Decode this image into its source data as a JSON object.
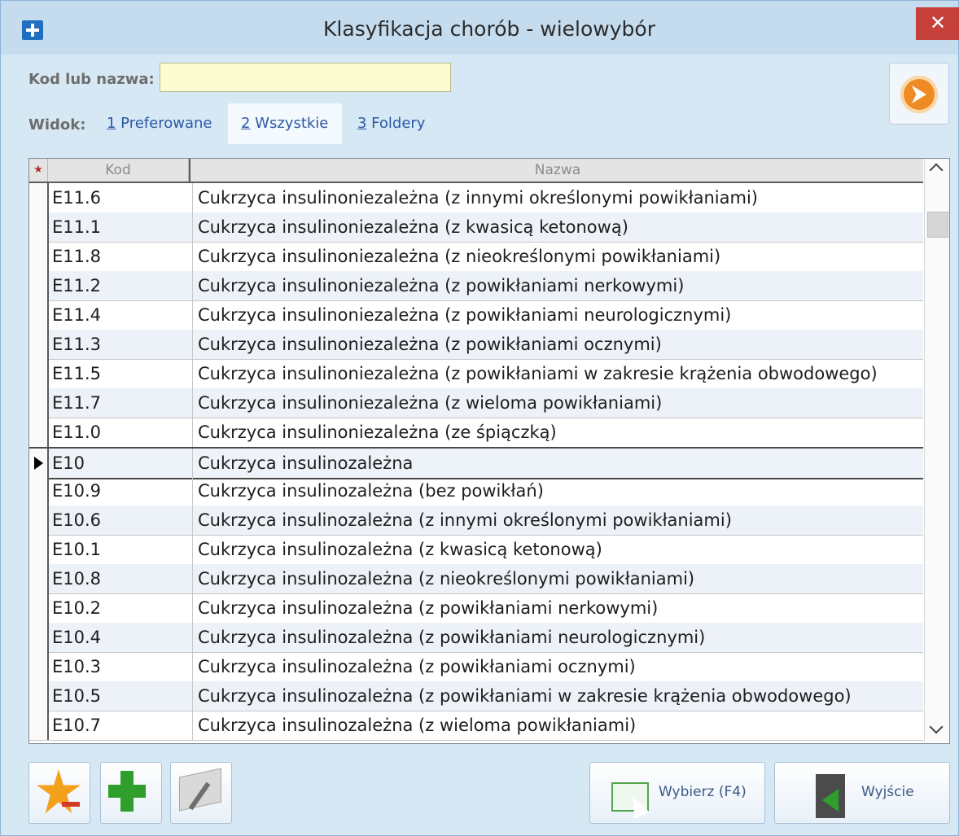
{
  "window": {
    "title": "Klasyfikacja chorób  - wielowybór",
    "close_glyph": "✕"
  },
  "search": {
    "label": "Kod lub nazwa:",
    "value": ""
  },
  "view": {
    "label": "Widok:",
    "tabs": [
      {
        "key": "1",
        "label": " Preferowane",
        "active": false
      },
      {
        "key": "2",
        "label": " Wszystkie",
        "active": true
      },
      {
        "key": "3",
        "label": " Foldery",
        "active": false
      }
    ]
  },
  "grid": {
    "star_header": "★",
    "columns": [
      "Kod",
      "Nazwa"
    ],
    "current_row_index": 9,
    "rows": [
      {
        "code": "E11.6",
        "name": "Cukrzyca insulinoniezależna (z innymi określonymi powikłaniami)"
      },
      {
        "code": "E11.1",
        "name": "Cukrzyca insulinoniezależna (z kwasicą ketonową)"
      },
      {
        "code": "E11.8",
        "name": "Cukrzyca insulinoniezależna (z nieokreślonymi powikłaniami)"
      },
      {
        "code": "E11.2",
        "name": "Cukrzyca insulinoniezależna (z powikłaniami nerkowymi)"
      },
      {
        "code": "E11.4",
        "name": "Cukrzyca insulinoniezależna (z powikłaniami neurologicznymi)"
      },
      {
        "code": "E11.3",
        "name": "Cukrzyca insulinoniezależna (z powikłaniami ocznymi)"
      },
      {
        "code": "E11.5",
        "name": "Cukrzyca insulinoniezależna (z powikłaniami w zakresie krążenia obwodowego)"
      },
      {
        "code": "E11.7",
        "name": "Cukrzyca insulinoniezależna (z wieloma powikłaniami)"
      },
      {
        "code": "E11.0",
        "name": "Cukrzyca insulinoniezależna (ze śpiączką)"
      },
      {
        "code": "E10",
        "name": "Cukrzyca insulinozależna"
      },
      {
        "code": "E10.9",
        "name": "Cukrzyca insulinozależna (bez powikłań)"
      },
      {
        "code": "E10.6",
        "name": "Cukrzyca insulinozależna (z innymi określonymi powikłaniami)"
      },
      {
        "code": "E10.1",
        "name": "Cukrzyca insulinozależna (z kwasicą ketonową)"
      },
      {
        "code": "E10.8",
        "name": "Cukrzyca insulinozależna (z nieokreślonymi powikłaniami)"
      },
      {
        "code": "E10.2",
        "name": "Cukrzyca insulinozależna (z powikłaniami nerkowymi)"
      },
      {
        "code": "E10.4",
        "name": "Cukrzyca insulinozależna (z powikłaniami neurologicznymi)"
      },
      {
        "code": "E10.3",
        "name": "Cukrzyca insulinozależna (z powikłaniami ocznymi)"
      },
      {
        "code": "E10.5",
        "name": "Cukrzyca insulinozależna (z powikłaniami w zakresie krążenia obwodowego)"
      },
      {
        "code": "E10.7",
        "name": "Cukrzyca insulinozależna (z wieloma powikłaniami)"
      }
    ]
  },
  "buttons": {
    "select_label": "Wybierz (F4)",
    "exit_label": "Wyjście"
  },
  "icons": {
    "app": "plus-icon",
    "corner": "orange-arrow-icon",
    "favorite_remove": "star-minus-icon",
    "add": "green-plus-icon",
    "edit": "edit-note-icon",
    "select": "list-select-icon",
    "exit": "exit-door-icon"
  },
  "colors": {
    "titlebar": "#c5dcee",
    "window_bg": "#d7e8f5",
    "close": "#c5403b",
    "search_bg": "#fdfbd2",
    "link": "#2b59a6"
  }
}
